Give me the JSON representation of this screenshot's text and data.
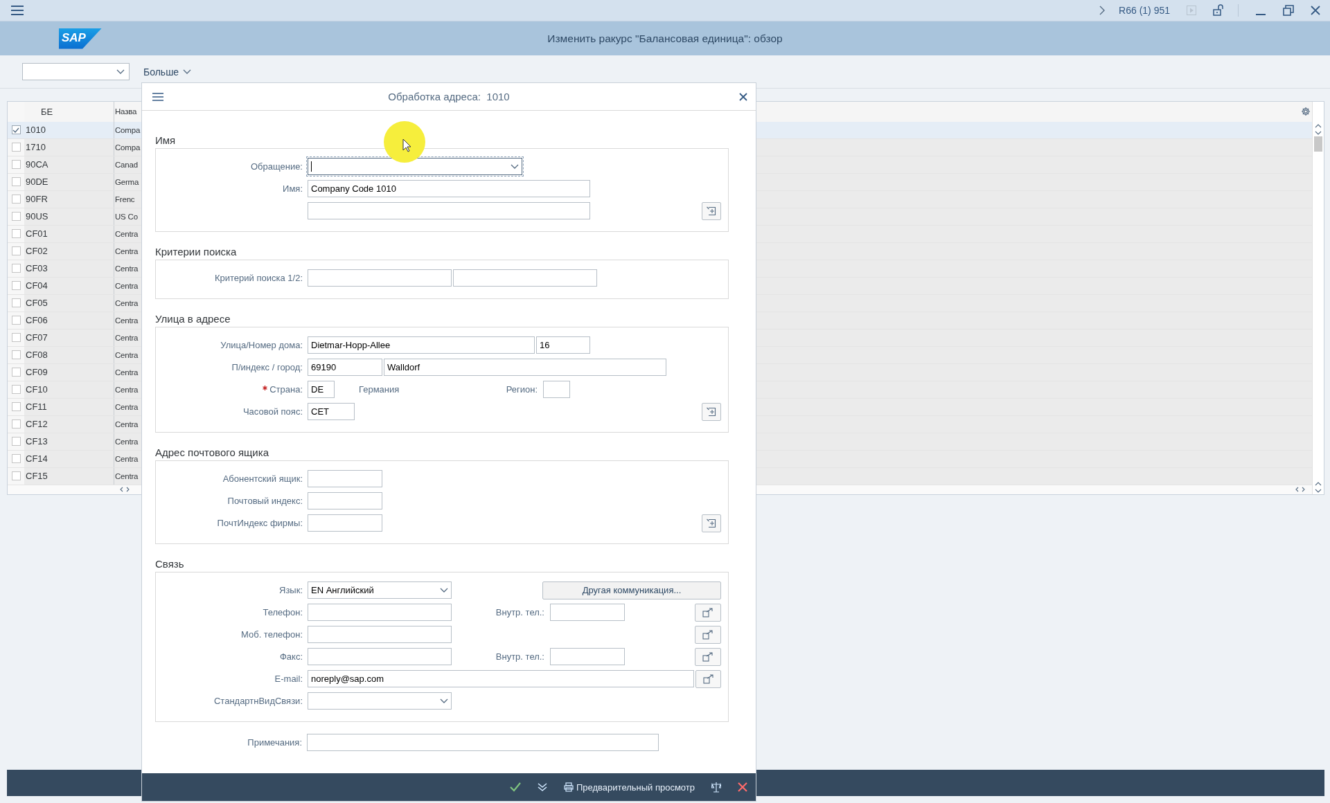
{
  "top_bar": {
    "system": "R66 (1) 951"
  },
  "header": {
    "logo": "SAP",
    "title": "Изменить ракурс \"Балансовая единица\": обзор"
  },
  "toolbar": {
    "menu": "Больше"
  },
  "table": {
    "columns": [
      "БЕ",
      "Назва"
    ],
    "rows": [
      {
        "code": "1010",
        "name": "Compa",
        "selected": true
      },
      {
        "code": "1710",
        "name": "Compa",
        "selected": false
      },
      {
        "code": "90CA",
        "name": "Canad",
        "selected": false
      },
      {
        "code": "90DE",
        "name": "Germa",
        "selected": false
      },
      {
        "code": "90FR",
        "name": "Frenc",
        "selected": false
      },
      {
        "code": "90US",
        "name": "US Co",
        "selected": false
      },
      {
        "code": "CF01",
        "name": "Centra",
        "selected": false
      },
      {
        "code": "CF02",
        "name": "Centra",
        "selected": false
      },
      {
        "code": "CF03",
        "name": "Centra",
        "selected": false
      },
      {
        "code": "CF04",
        "name": "Centra",
        "selected": false
      },
      {
        "code": "CF05",
        "name": "Centra",
        "selected": false
      },
      {
        "code": "CF06",
        "name": "Centra",
        "selected": false
      },
      {
        "code": "CF07",
        "name": "Centra",
        "selected": false
      },
      {
        "code": "CF08",
        "name": "Centra",
        "selected": false
      },
      {
        "code": "CF09",
        "name": "Centra",
        "selected": false
      },
      {
        "code": "CF10",
        "name": "Centra",
        "selected": false
      },
      {
        "code": "CF11",
        "name": "Centra",
        "selected": false
      },
      {
        "code": "CF12",
        "name": "Centra",
        "selected": false
      },
      {
        "code": "CF13",
        "name": "Centra",
        "selected": false
      },
      {
        "code": "CF14",
        "name": "Centra",
        "selected": false
      },
      {
        "code": "CF15",
        "name": "Centra",
        "selected": false
      }
    ]
  },
  "dialog": {
    "title": "Обработка адреса:  1010",
    "sections": [
      {
        "title": "Имя",
        "rows": [
          {
            "label": "Обращение:",
            "items": [
              {
                "kind": "dropdown",
                "focused": true
              }
            ]
          },
          {
            "label": "Имя:",
            "items": [
              {
                "kind": "field",
                "value": "Company Code 1010"
              }
            ]
          },
          {
            "items": [
              {
                "kind": "field"
              },
              {
                "kind": "expand"
              }
            ]
          }
        ]
      },
      {
        "title": "Критерии поиска",
        "rows": [
          {
            "label": "Критерий поиска 1/2:",
            "items": [
              {
                "kind": "field"
              },
              {
                "kind": "field"
              }
            ]
          }
        ]
      },
      {
        "title": "Улица в адресе",
        "rows": [
          {
            "label": "Улица/Номер дома:",
            "items": [
              {
                "kind": "field",
                "value": "Dietmar-Hopp-Allee"
              },
              {
                "kind": "field",
                "value": "16"
              }
            ]
          },
          {
            "label": "П/индекс / город:",
            "items": [
              {
                "kind": "field",
                "value": "69190"
              },
              {
                "kind": "field",
                "value": "Walldorf"
              }
            ]
          },
          {
            "label": "Страна:",
            "required": true,
            "items": [
              {
                "kind": "field",
                "value": "DE"
              },
              {
                "kind": "text",
                "text": "Германия"
              },
              {
                "kind": "label",
                "text": "Регион:"
              },
              {
                "kind": "field"
              }
            ]
          },
          {
            "label": "Часовой пояс:",
            "items": [
              {
                "kind": "field",
                "value": "CET"
              },
              {
                "kind": "expand"
              }
            ]
          }
        ]
      },
      {
        "title": "Адрес почтового ящика",
        "rows": [
          {
            "label": "Абонентский ящик:",
            "items": [
              {
                "kind": "field"
              }
            ]
          },
          {
            "label": "Почтовый индекс:",
            "items": [
              {
                "kind": "field"
              }
            ]
          },
          {
            "label": "ПочтИндекс фирмы:",
            "items": [
              {
                "kind": "field"
              },
              {
                "kind": "expand"
              }
            ]
          }
        ]
      },
      {
        "title": "Связь",
        "rows": [
          {
            "label": "Язык:",
            "items": [
              {
                "kind": "dropdown",
                "value": "EN Английский"
              },
              {
                "kind": "button",
                "text": "Другая коммуникация..."
              }
            ]
          },
          {
            "label": "Телефон:",
            "items": [
              {
                "kind": "field"
              },
              {
                "kind": "label",
                "text": "Внутр. тел.:"
              },
              {
                "kind": "field"
              },
              {
                "kind": "send"
              }
            ]
          },
          {
            "label": "Моб. телефон:",
            "items": [
              {
                "kind": "field"
              },
              {
                "kind": "send"
              }
            ]
          },
          {
            "label": "Факс:",
            "items": [
              {
                "kind": "field"
              },
              {
                "kind": "label",
                "text": "Внутр. тел.:"
              },
              {
                "kind": "field"
              },
              {
                "kind": "send"
              }
            ]
          },
          {
            "label": "E-mail:",
            "items": [
              {
                "kind": "field",
                "value": "noreply@sap.com"
              },
              {
                "kind": "send"
              }
            ]
          },
          {
            "label": "СтандартнВидСвязи:",
            "items": [
              {
                "kind": "dropdown"
              }
            ]
          }
        ]
      }
    ],
    "remarks": {
      "label": "Примечания:"
    },
    "footer": {
      "preview": "Предварительный просмотр"
    }
  }
}
